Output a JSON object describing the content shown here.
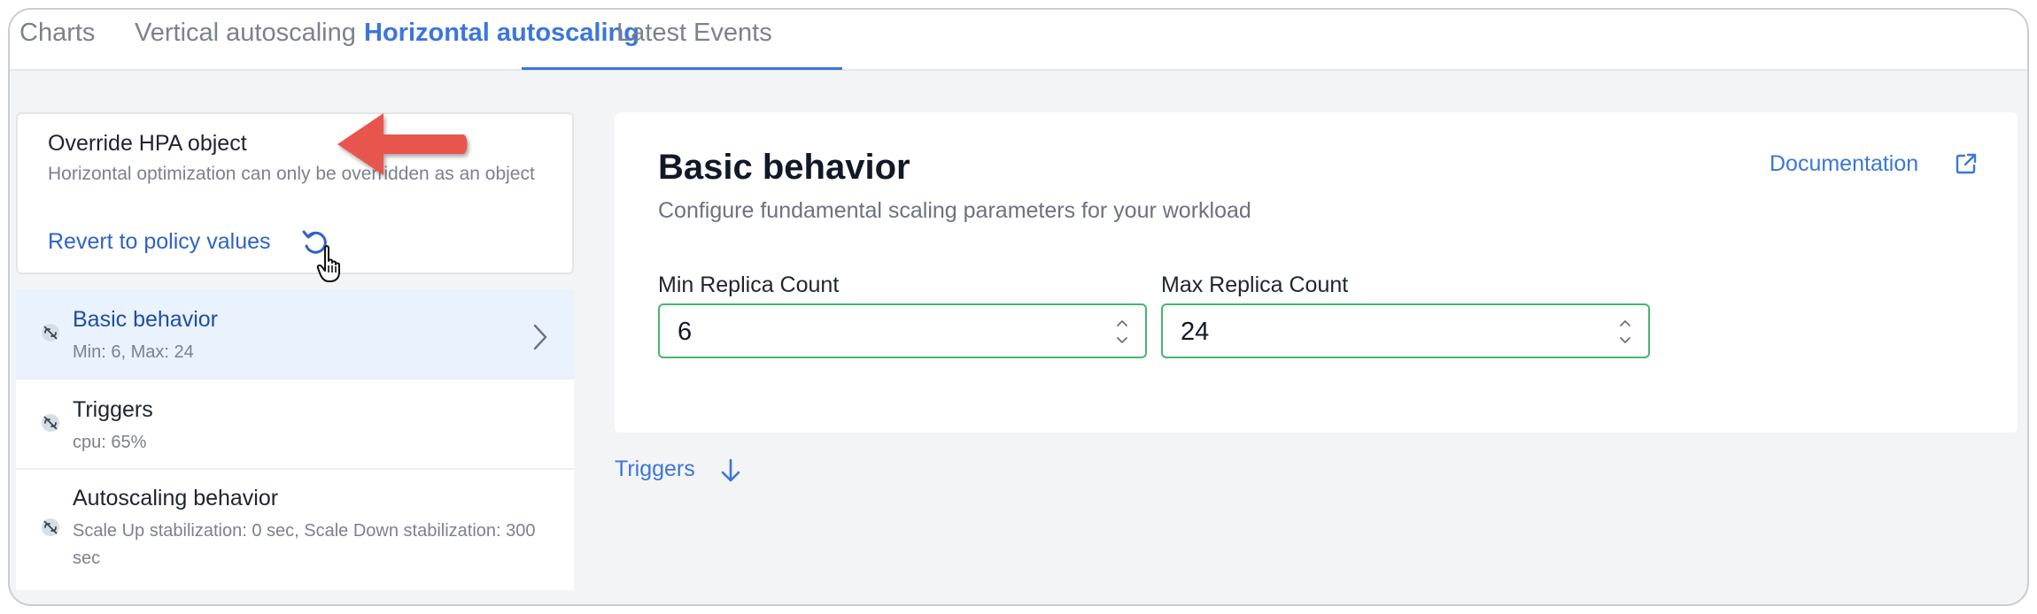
{
  "tabs": [
    {
      "label": "Charts",
      "active": false
    },
    {
      "label": "Vertical autoscaling",
      "active": false
    },
    {
      "label": "Horizontal autoscaling",
      "active": true
    },
    {
      "label": "Latest Events",
      "active": false
    }
  ],
  "override": {
    "title": "Override HPA object",
    "description": "Horizontal optimization can only be overridden as an object",
    "revert_label": "Revert to policy values",
    "revert_icon": "undo-icon"
  },
  "nav": {
    "items": [
      {
        "title": "Basic behavior",
        "subtitle": "Min: 6, Max: 24",
        "icon": "link-off-icon",
        "active": true
      },
      {
        "title": "Triggers",
        "subtitle": "cpu: 65%",
        "icon": "link-off-icon",
        "active": false
      },
      {
        "title": "Autoscaling behavior",
        "subtitle": "Scale Up stabilization: 0 sec, Scale Down stabilization: 300 sec",
        "icon": "link-off-icon",
        "active": false
      }
    ]
  },
  "main": {
    "title": "Basic behavior",
    "description": "Configure fundamental scaling parameters for your workload",
    "doc_link": "Documentation",
    "fields": [
      {
        "label": "Min Replica Count",
        "value": "6"
      },
      {
        "label": "Max Replica Count",
        "value": "24"
      }
    ]
  },
  "triggers_link": "Triggers",
  "colors": {
    "accent": "#3b76db",
    "link": "#2f62c9",
    "input_border": "#47b56f",
    "annotation_arrow": "#e8554e",
    "active_nav_bg": "#eaf2fe"
  }
}
